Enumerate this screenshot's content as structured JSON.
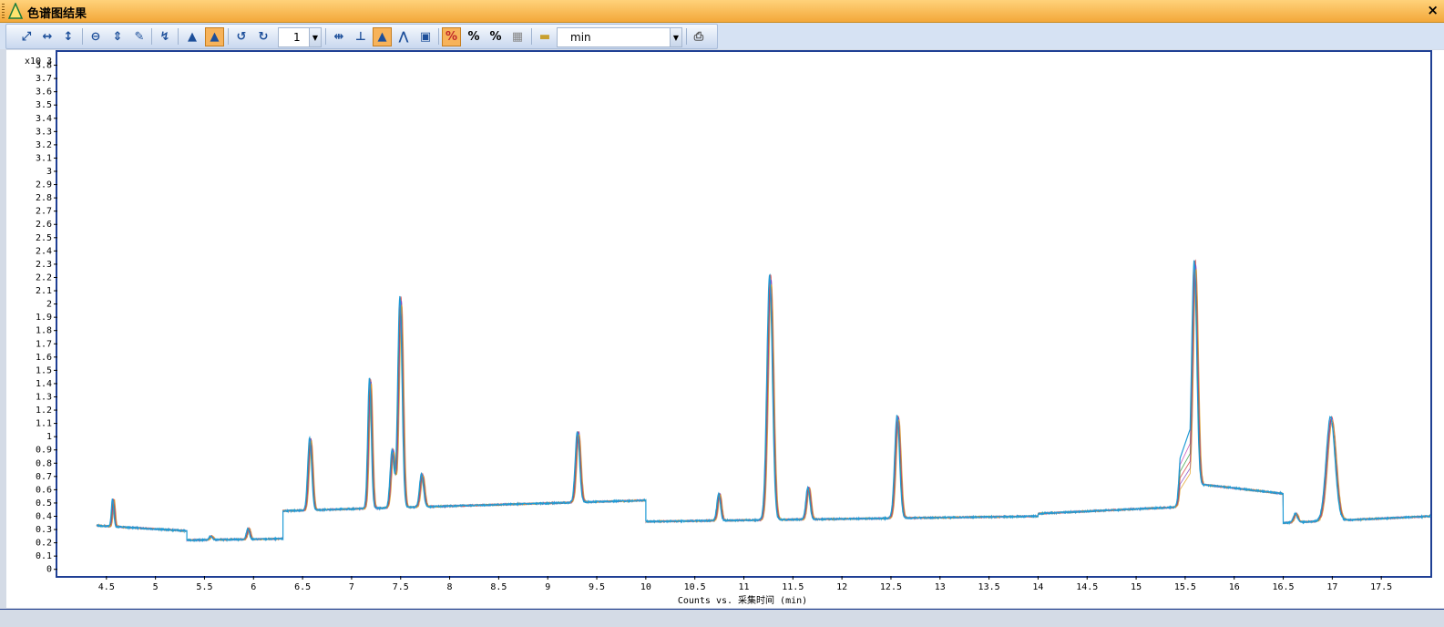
{
  "window": {
    "title": "色谱图结果",
    "close_glyph": "×"
  },
  "toolbar": {
    "buttons": [
      {
        "name": "autoscale-both-icon",
        "glyph": "⤢"
      },
      {
        "name": "autoscale-x-icon",
        "glyph": "↔"
      },
      {
        "name": "autoscale-y-icon",
        "glyph": "↕"
      },
      {
        "name": "zoom-out-icon",
        "glyph": "⊖"
      },
      {
        "name": "fit-height-icon",
        "glyph": "⇕"
      },
      {
        "name": "peak-label-icon",
        "glyph": "✎"
      },
      {
        "name": "integrate-icon",
        "glyph": "↯"
      },
      {
        "name": "overlay-peaks-icon",
        "glyph": "▲"
      },
      {
        "name": "multi-peak-icon",
        "glyph": "▲"
      },
      {
        "name": "undo-icon",
        "glyph": "↺"
      },
      {
        "name": "redo-icon",
        "glyph": "↻"
      },
      {
        "name": "x-range-icon",
        "glyph": "⇹"
      },
      {
        "name": "peak-marker-icon",
        "glyph": "⊥"
      },
      {
        "name": "peak-fill-icon",
        "glyph": "▲"
      },
      {
        "name": "peak-split-icon",
        "glyph": "⋀"
      },
      {
        "name": "export-image-icon",
        "glyph": "▣"
      },
      {
        "name": "percent-off-icon",
        "glyph": "%"
      },
      {
        "name": "percent-icon",
        "glyph": "%"
      },
      {
        "name": "percent-ratio-icon",
        "glyph": "%"
      },
      {
        "name": "grid-toggle-icon",
        "glyph": "▦"
      },
      {
        "name": "color-scheme-icon",
        "glyph": "▬"
      },
      {
        "name": "print-icon",
        "glyph": "⎙"
      }
    ],
    "count_value": "1",
    "unit_value": "min"
  },
  "chart_data": {
    "type": "line",
    "xlabel": "Counts vs. 采集时间 (min)",
    "ylabel_multiplier": "x10 3",
    "xlim": [
      4.0,
      18.0
    ],
    "ylim": [
      -0.05,
      3.9
    ],
    "x_ticks": [
      "4.5",
      "5",
      "5.5",
      "6",
      "6.5",
      "7",
      "7.5",
      "8",
      "8.5",
      "9",
      "9.5",
      "10",
      "10.5",
      "11",
      "11.5",
      "12",
      "12.5",
      "13",
      "13.5",
      "14",
      "14.5",
      "15",
      "15.5",
      "16",
      "16.5",
      "17",
      "17.5"
    ],
    "y_ticks": [
      "0",
      "0.1",
      "0.2",
      "0.3",
      "0.4",
      "0.5",
      "0.6",
      "0.7",
      "0.8",
      "0.9",
      "1",
      "1.1",
      "1.2",
      "1.3",
      "1.4",
      "1.5",
      "1.6",
      "1.7",
      "1.8",
      "1.9",
      "2",
      "2.1",
      "2.2",
      "2.3",
      "2.4",
      "2.5",
      "2.6",
      "2.7",
      "2.8",
      "2.9",
      "3",
      "3.1",
      "3.2",
      "3.3",
      "3.4",
      "3.5",
      "3.6",
      "3.7",
      "3.8"
    ],
    "segments": [
      {
        "x0": 4.4,
        "x1": 5.32,
        "b0": 0.33,
        "b1": 0.29
      },
      {
        "x0": 5.32,
        "x1": 6.3,
        "b0": 0.22,
        "b1": 0.23
      },
      {
        "x0": 6.3,
        "x1": 10.0,
        "b0": 0.44,
        "b1": 0.52
      },
      {
        "x0": 10.0,
        "x1": 14.0,
        "b0": 0.36,
        "b1": 0.4
      },
      {
        "x0": 14.0,
        "x1": 15.45,
        "b0": 0.42,
        "b1": 0.47
      },
      {
        "x0": 15.55,
        "x1": 16.5,
        "b0": 0.65,
        "b1": 0.57
      },
      {
        "x0": 16.5,
        "x1": 18.0,
        "b0": 0.35,
        "b1": 0.4
      }
    ],
    "peaks": [
      {
        "x": 4.57,
        "h": 0.53,
        "w": 0.012
      },
      {
        "x": 5.57,
        "h": 0.25,
        "w": 0.015
      },
      {
        "x": 5.95,
        "h": 0.31,
        "w": 0.015
      },
      {
        "x": 6.58,
        "h": 0.99,
        "w": 0.02
      },
      {
        "x": 7.19,
        "h": 1.44,
        "w": 0.018
      },
      {
        "x": 7.42,
        "h": 0.9,
        "w": 0.02
      },
      {
        "x": 7.5,
        "h": 2.06,
        "w": 0.022
      },
      {
        "x": 7.72,
        "h": 0.72,
        "w": 0.02
      },
      {
        "x": 9.31,
        "h": 1.04,
        "w": 0.022
      },
      {
        "x": 10.75,
        "h": 0.57,
        "w": 0.018
      },
      {
        "x": 11.27,
        "h": 2.22,
        "w": 0.028
      },
      {
        "x": 11.66,
        "h": 0.62,
        "w": 0.02
      },
      {
        "x": 12.57,
        "h": 1.16,
        "w": 0.025
      },
      {
        "x": 15.47,
        "h": 0.92,
        "w": 0.022
      },
      {
        "x": 15.6,
        "h": 2.33,
        "w": 0.025
      },
      {
        "x": 16.63,
        "h": 0.42,
        "w": 0.02
      },
      {
        "x": 16.99,
        "h": 1.15,
        "w": 0.045
      }
    ],
    "series_colors": [
      "#1f9bd6",
      "#c23fb2",
      "#2e9d3a",
      "#d43a3a",
      "#7b3fc4",
      "#e0a020"
    ]
  }
}
